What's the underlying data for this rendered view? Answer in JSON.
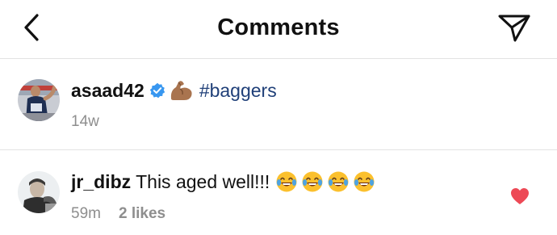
{
  "header": {
    "title": "Comments",
    "back_icon": "chevron-left-icon",
    "send_icon": "paper-plane-icon"
  },
  "caption": {
    "username": "asaad42",
    "verified": true,
    "emoji": "flexed-biceps",
    "hashtag": "#baggers",
    "time": "14w"
  },
  "comments": [
    {
      "username": "jr_dibz",
      "text": "This aged well!!!",
      "emoji_count": 4,
      "emoji": "face-with-tears-of-joy",
      "time": "59m",
      "likes": "2 likes",
      "liked": true
    }
  ],
  "colors": {
    "heart": "#ed4956",
    "hashtag": "#1f3f78",
    "verified": "#3897f0",
    "meta": "#8e8e8e"
  }
}
